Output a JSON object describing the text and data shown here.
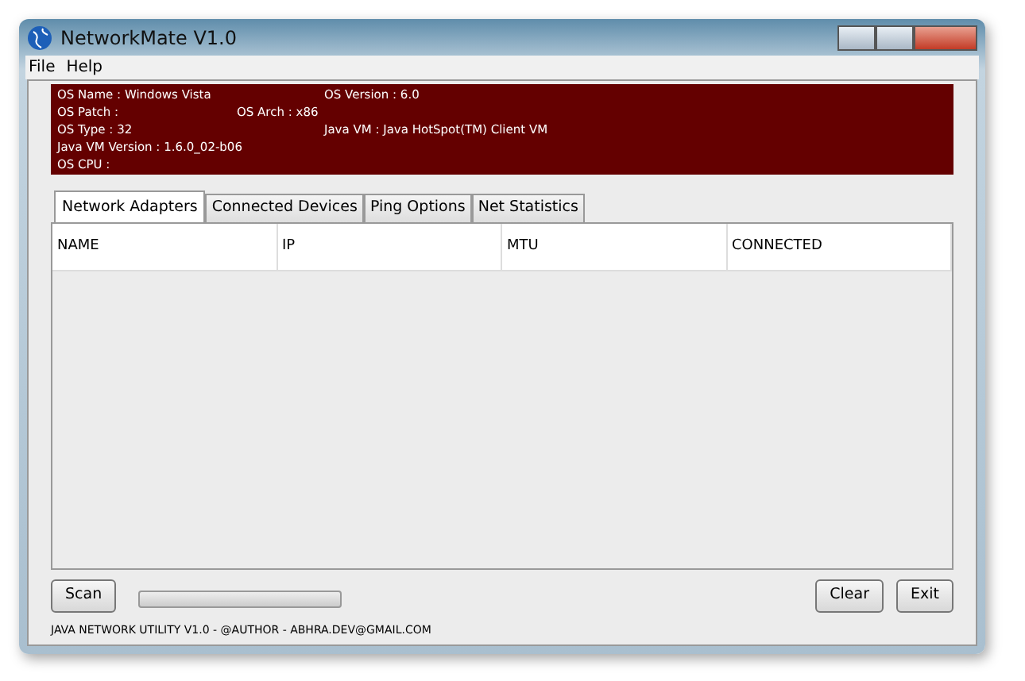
{
  "window": {
    "title": "NetworkMate V1.0"
  },
  "menu": [
    "File",
    "Help"
  ],
  "system_info": [
    {
      "left": "OS Name : Windows Vista",
      "right": "OS Version : 6.0"
    },
    {
      "left": "OS Patch :",
      "middle": "OS Arch : x86"
    },
    {
      "left": "OS Type  : 32",
      "right": "Java VM : Java HotSpot(TM) Client VM"
    },
    {
      "left": "Java VM Version : 1.6.0_02-b06"
    },
    {
      "left": "OS CPU :"
    }
  ],
  "tabs": [
    {
      "label": "Network Adapters",
      "selected": true
    },
    {
      "label": "Connected Devices",
      "selected": false
    },
    {
      "label": "Ping Options",
      "selected": false
    },
    {
      "label": "Net Statistics",
      "selected": false
    }
  ],
  "table": {
    "columns": [
      "NAME",
      "IP",
      "MTU",
      "CONNECTED"
    ]
  },
  "scan_button": "Scan",
  "progress": {
    "level": 0
  },
  "buttons": [
    "Clear",
    "Exit"
  ],
  "footer": "JAVA NETWORK UTILITY V1.0 - @AUTHOR - ABHRA.DEV@GMAIL.COM"
}
